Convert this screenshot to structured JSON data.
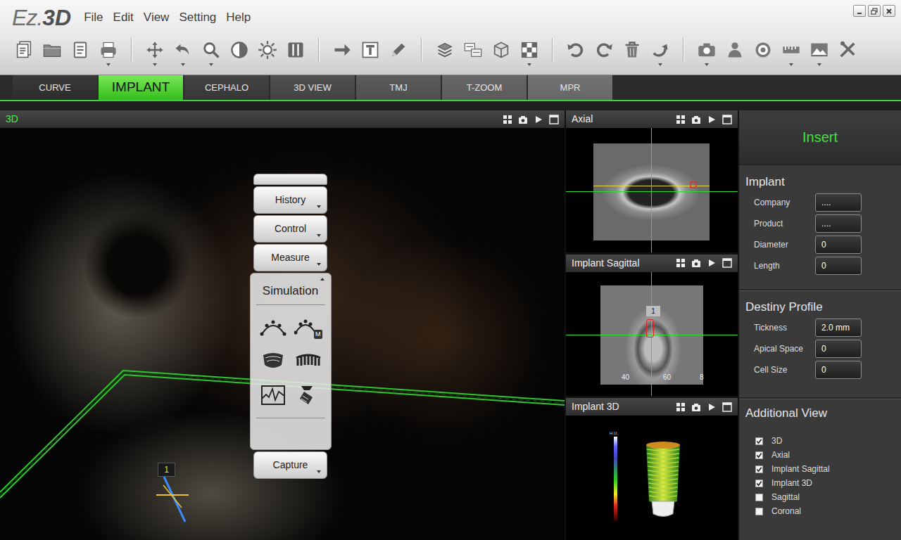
{
  "window": {
    "logo": {
      "prefix": "Ez.",
      "suffix": "3D"
    }
  },
  "menu": [
    "File",
    "Edit",
    "View",
    "Setting",
    "Help"
  ],
  "tabs": [
    {
      "label": "CURVE",
      "selected": false
    },
    {
      "label": "IMPLANT",
      "selected": true
    },
    {
      "label": "CEPHALO",
      "selected": false
    },
    {
      "label": "3D VIEW",
      "selected": false
    },
    {
      "label": "TMJ",
      "selected": false
    },
    {
      "label": "T-ZOOM",
      "selected": false
    },
    {
      "label": "MPR",
      "selected": false
    }
  ],
  "views": {
    "main": {
      "title": "3D",
      "implant_label": "1"
    },
    "axial": {
      "title": "Axial"
    },
    "implant_sagittal": {
      "title": "Implant Sagittal",
      "implant_label": "1",
      "ruler": [
        "40",
        "60",
        "8"
      ]
    },
    "implant_3d": {
      "title": "Implant 3D",
      "scale_label": "H.U."
    }
  },
  "tool_menu": {
    "items": [
      {
        "label": "History",
        "expanded": false
      },
      {
        "label": "Control",
        "expanded": false
      },
      {
        "label": "Measure",
        "expanded": false
      },
      {
        "label": "Simulation",
        "expanded": true
      },
      {
        "label": "Capture",
        "expanded": false
      }
    ],
    "simulation_badge": "M"
  },
  "properties": {
    "header": "Insert",
    "sections": [
      {
        "title": "Implant",
        "fields": [
          {
            "label": "Company",
            "value": "...."
          },
          {
            "label": "Product",
            "value": "...."
          },
          {
            "label": "Diameter",
            "value": "0"
          },
          {
            "label": "Length",
            "value": "0"
          }
        ]
      },
      {
        "title": "Destiny Profile",
        "fields": [
          {
            "label": "Tickness",
            "value": "2.0 mm"
          },
          {
            "label": "Apical Space",
            "value": "0"
          },
          {
            "label": "Cell Size",
            "value": "0"
          }
        ]
      }
    ],
    "additional_view": {
      "title": "Additional View",
      "items": [
        {
          "label": "3D",
          "checked": true
        },
        {
          "label": "Axial",
          "checked": true
        },
        {
          "label": "Implant Sagittal",
          "checked": true
        },
        {
          "label": "Implant 3D",
          "checked": true
        },
        {
          "label": "Sagittal",
          "checked": false
        },
        {
          "label": "Coronal",
          "checked": false
        }
      ]
    }
  }
}
